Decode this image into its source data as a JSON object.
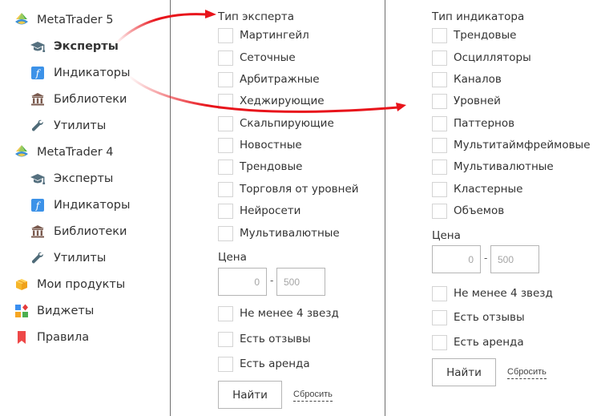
{
  "sidebar": {
    "groups": [
      {
        "label": "MetaTrader 5",
        "icon": "metatrader-logo-icon",
        "items": [
          {
            "label": "Эксперты",
            "icon": "graduation-cap-icon",
            "active": true
          },
          {
            "label": "Индикаторы",
            "icon": "function-icon",
            "active": false
          },
          {
            "label": "Библиотеки",
            "icon": "library-building-icon",
            "active": false
          },
          {
            "label": "Утилиты",
            "icon": "wrench-icon",
            "active": false
          }
        ]
      },
      {
        "label": "MetaTrader 4",
        "icon": "metatrader-logo-icon",
        "items": [
          {
            "label": "Эксперты",
            "icon": "graduation-cap-icon",
            "active": false
          },
          {
            "label": "Индикаторы",
            "icon": "function-icon",
            "active": false
          },
          {
            "label": "Библиотеки",
            "icon": "library-building-icon",
            "active": false
          },
          {
            "label": "Утилиты",
            "icon": "wrench-icon",
            "active": false
          }
        ]
      }
    ],
    "extra": [
      {
        "label": "Мои продукты",
        "icon": "box-icon"
      },
      {
        "label": "Виджеты",
        "icon": "widgets-icon"
      },
      {
        "label": "Правила",
        "icon": "bookmark-icon"
      }
    ]
  },
  "experts_filter": {
    "title": "Тип эксперта",
    "types": [
      "Мартингейл",
      "Сеточные",
      "Арбитражные",
      "Хеджирующие",
      "Скальпирующие",
      "Новостные",
      "Трендовые",
      "Торговля от уровней",
      "Нейросети",
      "Мультивалютные"
    ],
    "price_label": "Цена",
    "price_from_placeholder": "0",
    "price_separator": "-",
    "price_to_placeholder": "500",
    "options": [
      "Не менее 4 звезд",
      "Есть отзывы",
      "Есть аренда"
    ],
    "find_label": "Найти",
    "reset_label": "Сбросить"
  },
  "indicators_filter": {
    "title": "Тип индикатора",
    "types": [
      "Трендовые",
      "Осцилляторы",
      "Каналов",
      "Уровней",
      "Паттернов",
      "Мультитаймфреймовые",
      "Мультивалютные",
      "Кластерные",
      "Объемов"
    ],
    "price_label": "Цена",
    "price_from_placeholder": "0",
    "price_separator": "-",
    "price_to_placeholder": "500",
    "options": [
      "Не менее 4 звезд",
      "Есть отзывы",
      "Есть аренда"
    ],
    "find_label": "Найти",
    "reset_label": "Сбросить"
  },
  "colors": {
    "arrow": "#e8141b",
    "divider": "#6f6f6f",
    "checkbox_border": "#d4d4d4",
    "input_border": "#b5b5b5"
  }
}
